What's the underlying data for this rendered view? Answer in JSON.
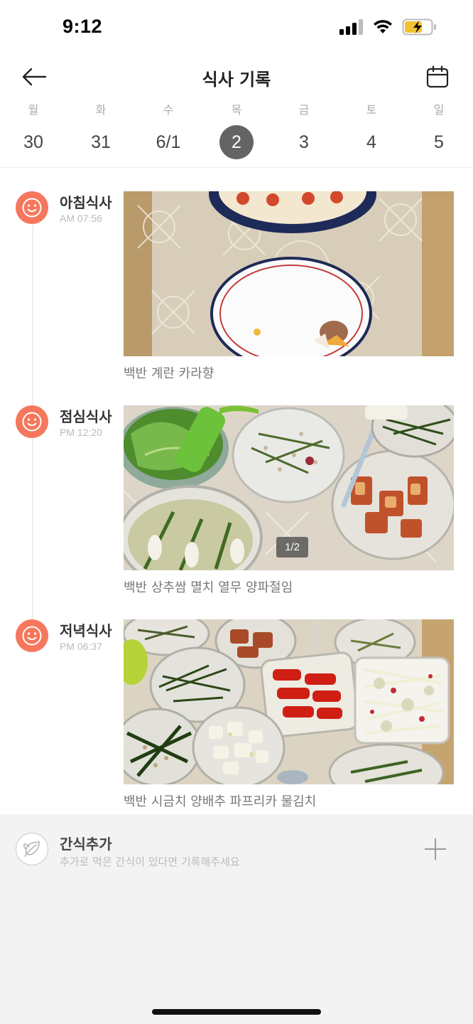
{
  "status_bar": {
    "time": "9:12"
  },
  "header": {
    "title": "식사 기록"
  },
  "week": [
    {
      "name": "월",
      "num": "30",
      "selected": false
    },
    {
      "name": "화",
      "num": "31",
      "selected": false
    },
    {
      "name": "수",
      "num": "6/1",
      "selected": false
    },
    {
      "name": "목",
      "num": "2",
      "selected": true
    },
    {
      "name": "금",
      "num": "3",
      "selected": false
    },
    {
      "name": "토",
      "num": "4",
      "selected": false
    },
    {
      "name": "일",
      "num": "5",
      "selected": false
    }
  ],
  "meals": [
    {
      "label": "아침식사",
      "time": "AM 07:56",
      "description": "백반 계란 카라향",
      "counter": ""
    },
    {
      "label": "점심식사",
      "time": "PM 12:20",
      "description": "백반 상추쌈 멸치 열무 양파절임",
      "counter": "1/2"
    },
    {
      "label": "저녁식사",
      "time": "PM 06:37",
      "description": "백반 시금치 양배추 파프리카 물김치",
      "counter": ""
    }
  ],
  "snack": {
    "title": "간식추가",
    "subtitle": "추가로 먹은 간식이 있다면 기록해주세요"
  },
  "icons": {
    "back": "arrow-left-icon",
    "calendar": "calendar-icon",
    "meal": "smiley-face-icon",
    "snack": "leaf-icon",
    "add": "plus-icon"
  },
  "colors": {
    "accent": "#f6775d",
    "selected_day": "#646464"
  }
}
